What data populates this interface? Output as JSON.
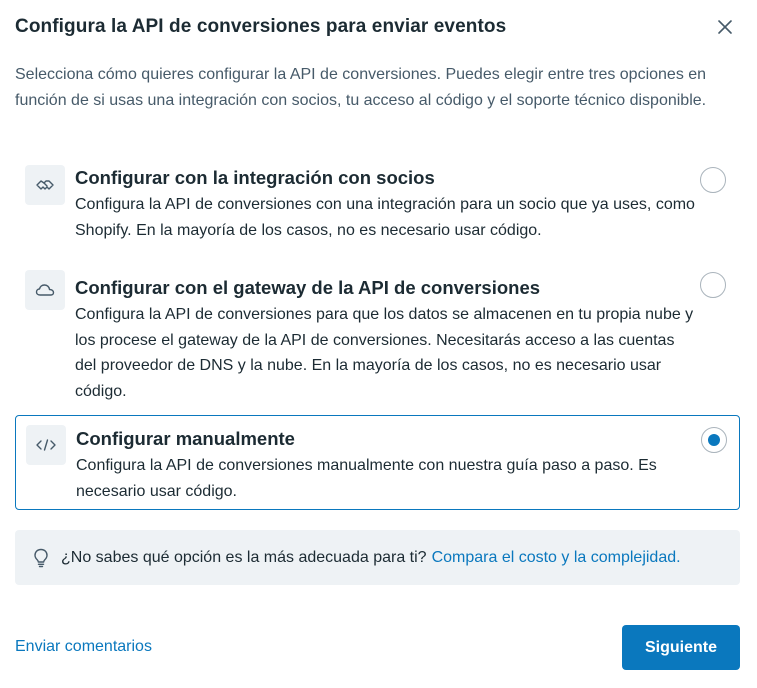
{
  "dialog": {
    "title": "Configura la API de conversiones para enviar eventos",
    "close_icon": "close-icon",
    "intro": "Selecciona cómo quieres configurar la API de conversiones. Puedes elegir entre tres opciones en función de si usas una integración con socios, tu acceso al código y el soporte técnico disponible."
  },
  "options": [
    {
      "icon": "handshake-icon",
      "title": "Configurar con la integración con socios",
      "description": "Configura la API de conversiones con una integración para un socio que ya uses, como Shopify. En la mayoría de los casos, no es necesario usar código.",
      "selected": false
    },
    {
      "icon": "cloud-icon",
      "title": "Configurar con el gateway de la API de conversiones",
      "description": "Configura la API de conversiones para que los datos se almacenen en tu propia nube y los procese el gateway de la API de conversiones. Necesitarás acceso a las cuentas del proveedor de DNS y la nube. En la mayoría de los casos, no es necesario usar código.",
      "selected": false
    },
    {
      "icon": "code-icon",
      "title": "Configurar manualmente",
      "description": "Configura la API de conversiones manualmente con nuestra guía paso a paso. Es necesario usar código.",
      "selected": true
    }
  ],
  "hint": {
    "icon": "lightbulb-icon",
    "text": "¿No sabes qué opción es la más adecuada para ti?",
    "link": "Compara el costo y la complejidad."
  },
  "footer": {
    "feedback_link": "Enviar comentarios",
    "next_button": "Siguiente"
  },
  "colors": {
    "accent": "#0a78be",
    "text": "#1c2b33",
    "muted_text": "#465a69",
    "icon_bg": "#eef2f5",
    "hint_bg": "#eef2f5"
  }
}
